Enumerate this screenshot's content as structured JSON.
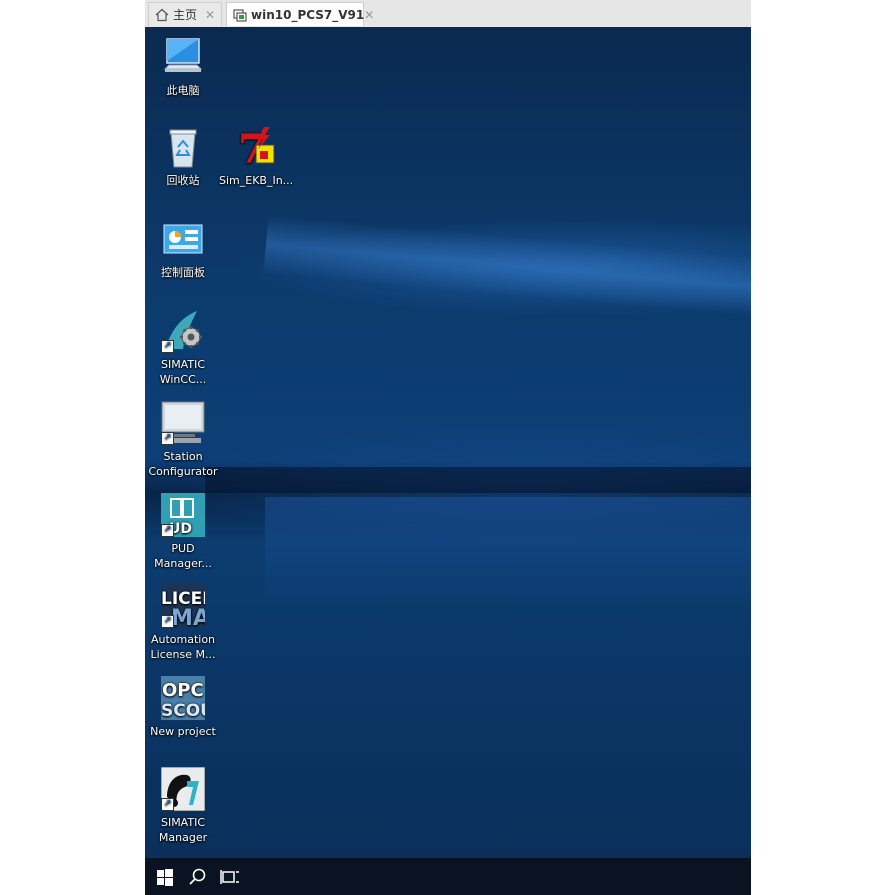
{
  "tabs": [
    {
      "label": "主页",
      "icon": "home-icon"
    },
    {
      "label": "win10_PCS7_V91",
      "icon": "vm-icon",
      "active": true
    }
  ],
  "desktop": {
    "icons": [
      {
        "label": "此电脑",
        "icon": "computer-icon"
      },
      {
        "label": "回收站",
        "icon": "recycle-bin-icon"
      },
      {
        "label": "Sim_EKB_In...",
        "icon": "sim-ekb-icon"
      },
      {
        "label": "控制面板",
        "icon": "control-panel-icon"
      },
      {
        "label": "SIMATIC\nWinCC...",
        "icon": "wincc-icon"
      },
      {
        "label": "Station\nConfigurator",
        "icon": "station-configurator-icon"
      },
      {
        "label": "PUD\nManager...",
        "icon": "pud-manager-icon"
      },
      {
        "label": "Automation\nLicense M...",
        "icon": "license-manager-icon"
      },
      {
        "label": "New project",
        "icon": "opc-scout-icon"
      },
      {
        "label": "SIMATIC\nManager",
        "icon": "simatic-manager-icon"
      }
    ]
  },
  "taskbar": {
    "buttons": [
      {
        "icon": "windows-start-icon"
      },
      {
        "icon": "search-icon"
      },
      {
        "icon": "task-view-icon"
      }
    ]
  },
  "glyph_text": {
    "pud": "UD",
    "license_top": "LICEN",
    "license_bottom": "MA",
    "opc_top": "OPC",
    "opc_bottom": "SCOU"
  },
  "colors": {
    "desktop_bg": "#0b2a4e",
    "taskbar_bg": "#0b1322"
  }
}
